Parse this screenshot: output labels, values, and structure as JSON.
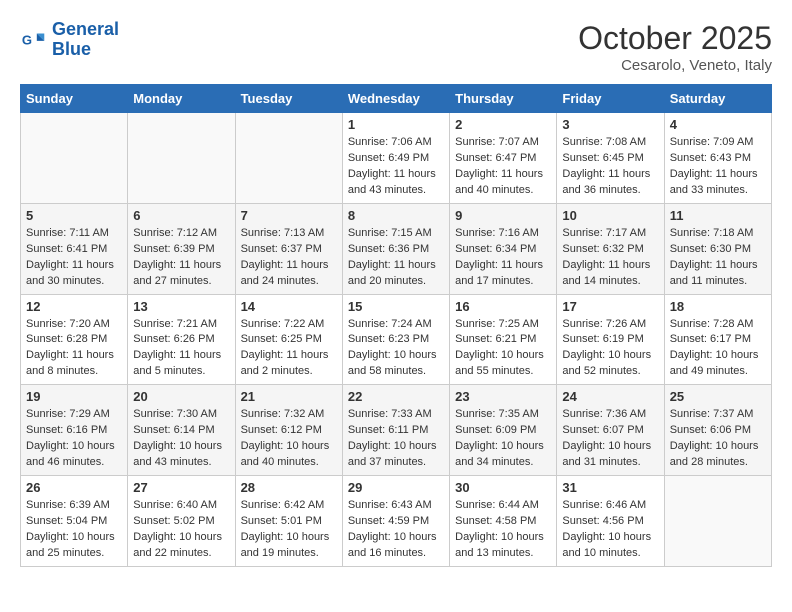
{
  "header": {
    "logo_line1": "General",
    "logo_line2": "Blue",
    "month": "October 2025",
    "location": "Cesarolo, Veneto, Italy"
  },
  "days_of_week": [
    "Sunday",
    "Monday",
    "Tuesday",
    "Wednesday",
    "Thursday",
    "Friday",
    "Saturday"
  ],
  "weeks": [
    [
      {
        "day": "",
        "info": ""
      },
      {
        "day": "",
        "info": ""
      },
      {
        "day": "",
        "info": ""
      },
      {
        "day": "1",
        "info": "Sunrise: 7:06 AM\nSunset: 6:49 PM\nDaylight: 11 hours and 43 minutes."
      },
      {
        "day": "2",
        "info": "Sunrise: 7:07 AM\nSunset: 6:47 PM\nDaylight: 11 hours and 40 minutes."
      },
      {
        "day": "3",
        "info": "Sunrise: 7:08 AM\nSunset: 6:45 PM\nDaylight: 11 hours and 36 minutes."
      },
      {
        "day": "4",
        "info": "Sunrise: 7:09 AM\nSunset: 6:43 PM\nDaylight: 11 hours and 33 minutes."
      }
    ],
    [
      {
        "day": "5",
        "info": "Sunrise: 7:11 AM\nSunset: 6:41 PM\nDaylight: 11 hours and 30 minutes."
      },
      {
        "day": "6",
        "info": "Sunrise: 7:12 AM\nSunset: 6:39 PM\nDaylight: 11 hours and 27 minutes."
      },
      {
        "day": "7",
        "info": "Sunrise: 7:13 AM\nSunset: 6:37 PM\nDaylight: 11 hours and 24 minutes."
      },
      {
        "day": "8",
        "info": "Sunrise: 7:15 AM\nSunset: 6:36 PM\nDaylight: 11 hours and 20 minutes."
      },
      {
        "day": "9",
        "info": "Sunrise: 7:16 AM\nSunset: 6:34 PM\nDaylight: 11 hours and 17 minutes."
      },
      {
        "day": "10",
        "info": "Sunrise: 7:17 AM\nSunset: 6:32 PM\nDaylight: 11 hours and 14 minutes."
      },
      {
        "day": "11",
        "info": "Sunrise: 7:18 AM\nSunset: 6:30 PM\nDaylight: 11 hours and 11 minutes."
      }
    ],
    [
      {
        "day": "12",
        "info": "Sunrise: 7:20 AM\nSunset: 6:28 PM\nDaylight: 11 hours and 8 minutes."
      },
      {
        "day": "13",
        "info": "Sunrise: 7:21 AM\nSunset: 6:26 PM\nDaylight: 11 hours and 5 minutes."
      },
      {
        "day": "14",
        "info": "Sunrise: 7:22 AM\nSunset: 6:25 PM\nDaylight: 11 hours and 2 minutes."
      },
      {
        "day": "15",
        "info": "Sunrise: 7:24 AM\nSunset: 6:23 PM\nDaylight: 10 hours and 58 minutes."
      },
      {
        "day": "16",
        "info": "Sunrise: 7:25 AM\nSunset: 6:21 PM\nDaylight: 10 hours and 55 minutes."
      },
      {
        "day": "17",
        "info": "Sunrise: 7:26 AM\nSunset: 6:19 PM\nDaylight: 10 hours and 52 minutes."
      },
      {
        "day": "18",
        "info": "Sunrise: 7:28 AM\nSunset: 6:17 PM\nDaylight: 10 hours and 49 minutes."
      }
    ],
    [
      {
        "day": "19",
        "info": "Sunrise: 7:29 AM\nSunset: 6:16 PM\nDaylight: 10 hours and 46 minutes."
      },
      {
        "day": "20",
        "info": "Sunrise: 7:30 AM\nSunset: 6:14 PM\nDaylight: 10 hours and 43 minutes."
      },
      {
        "day": "21",
        "info": "Sunrise: 7:32 AM\nSunset: 6:12 PM\nDaylight: 10 hours and 40 minutes."
      },
      {
        "day": "22",
        "info": "Sunrise: 7:33 AM\nSunset: 6:11 PM\nDaylight: 10 hours and 37 minutes."
      },
      {
        "day": "23",
        "info": "Sunrise: 7:35 AM\nSunset: 6:09 PM\nDaylight: 10 hours and 34 minutes."
      },
      {
        "day": "24",
        "info": "Sunrise: 7:36 AM\nSunset: 6:07 PM\nDaylight: 10 hours and 31 minutes."
      },
      {
        "day": "25",
        "info": "Sunrise: 7:37 AM\nSunset: 6:06 PM\nDaylight: 10 hours and 28 minutes."
      }
    ],
    [
      {
        "day": "26",
        "info": "Sunrise: 6:39 AM\nSunset: 5:04 PM\nDaylight: 10 hours and 25 minutes."
      },
      {
        "day": "27",
        "info": "Sunrise: 6:40 AM\nSunset: 5:02 PM\nDaylight: 10 hours and 22 minutes."
      },
      {
        "day": "28",
        "info": "Sunrise: 6:42 AM\nSunset: 5:01 PM\nDaylight: 10 hours and 19 minutes."
      },
      {
        "day": "29",
        "info": "Sunrise: 6:43 AM\nSunset: 4:59 PM\nDaylight: 10 hours and 16 minutes."
      },
      {
        "day": "30",
        "info": "Sunrise: 6:44 AM\nSunset: 4:58 PM\nDaylight: 10 hours and 13 minutes."
      },
      {
        "day": "31",
        "info": "Sunrise: 6:46 AM\nSunset: 4:56 PM\nDaylight: 10 hours and 10 minutes."
      },
      {
        "day": "",
        "info": ""
      }
    ]
  ]
}
